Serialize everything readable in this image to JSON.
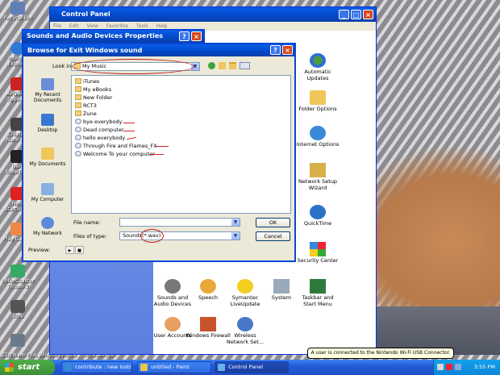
{
  "desktop": {
    "icons": [
      {
        "label": "Recycle Bin",
        "icon": "recycle-bin-icon"
      },
      {
        "label": "Internet Explorer",
        "icon": "internet-explorer-icon"
      },
      {
        "label": "AVG Anti-Spyware",
        "icon": "avg-icon"
      },
      {
        "label": "Creative Nano M...",
        "icon": "creative-icon"
      },
      {
        "label": "Nero ShowTime",
        "icon": "nero-icon"
      },
      {
        "label": "Nero StartSmart",
        "icon": "nero-start-icon"
      },
      {
        "label": "Play Games",
        "icon": "games-icon"
      },
      {
        "label": "RollerCoaster Tycoon 3",
        "icon": "rollercoaster-icon"
      },
      {
        "label": "Xfire",
        "icon": "xfire-icon"
      },
      {
        "label": "ZEN Nano Plus",
        "icon": "zen-icon"
      }
    ],
    "bottom_labels": [
      "Windows Media ...",
      "Minesweeper"
    ]
  },
  "control_panel": {
    "title": "Control Panel",
    "menu": [
      "File",
      "Edit",
      "View",
      "Favorites",
      "Tools",
      "Help"
    ],
    "items": [
      {
        "label": "Automatic Updates",
        "icon": "automatic-updates-icon"
      },
      {
        "label": "Folder Options",
        "icon": "folder-options-icon"
      },
      {
        "label": "Internet Options",
        "icon": "internet-options-icon"
      },
      {
        "label": "Network Setup Wizard",
        "icon": "network-setup-icon"
      },
      {
        "label": "QuickTime",
        "icon": "quicktime-icon"
      },
      {
        "label": "Security Center",
        "icon": "security-center-icon"
      },
      {
        "label": "Sounds and Audio Devices",
        "icon": "sounds-icon"
      },
      {
        "label": "Speech",
        "icon": "speech-icon"
      },
      {
        "label": "Symantec LiveUpdate",
        "icon": "liveupdate-icon"
      },
      {
        "label": "System",
        "icon": "system-icon"
      },
      {
        "label": "Taskbar and Start Menu",
        "icon": "taskbar-icon"
      },
      {
        "label": "User Accounts",
        "icon": "user-accounts-icon"
      },
      {
        "label": "Windows Firewall",
        "icon": "firewall-icon"
      },
      {
        "label": "Wireless Network Set...",
        "icon": "wireless-icon"
      }
    ]
  },
  "sounds_dialog": {
    "title": "Sounds and Audio Devices Properties"
  },
  "browse_dialog": {
    "title": "Browse for Exit Windows sound",
    "look_in_label": "Look in:",
    "look_in_value": "My Music",
    "places": [
      {
        "label": "My Recent Documents",
        "icon": "recent-documents-icon"
      },
      {
        "label": "Desktop",
        "icon": "desktop-icon"
      },
      {
        "label": "My Documents",
        "icon": "my-documents-icon"
      },
      {
        "label": "My Computer",
        "icon": "my-computer-icon"
      },
      {
        "label": "My Network",
        "icon": "my-network-icon"
      }
    ],
    "files": [
      {
        "name": "iTunes",
        "type": "folder"
      },
      {
        "name": "My eBooks",
        "type": "folder"
      },
      {
        "name": "New Folder",
        "type": "folder"
      },
      {
        "name": "RCT3",
        "type": "folder"
      },
      {
        "name": "Zune",
        "type": "folder"
      },
      {
        "name": "bye everybody",
        "type": "audio"
      },
      {
        "name": "Dead computer",
        "type": "audio"
      },
      {
        "name": "hello everybody",
        "type": "audio"
      },
      {
        "name": "Through Fire and Flames_FX",
        "type": "audio"
      },
      {
        "name": "Welcome To your computer",
        "type": "audio"
      }
    ],
    "file_name_label": "File name:",
    "file_name_value": "",
    "files_of_type_label": "Files of type:",
    "files_of_type_value": "Sounds(*.wav)",
    "preview_label": "Preview:",
    "ok_label": "OK",
    "cancel_label": "Cancel"
  },
  "tooltip": "A user is connected to the Nintendo Wi-Fi USB Connector.",
  "taskbar": {
    "start_label": "start",
    "tasks": [
      {
        "label": "contribute : new instr...",
        "active": false
      },
      {
        "label": "untitled - Paint",
        "active": false
      },
      {
        "label": "Control Panel",
        "active": true
      }
    ],
    "clock": "3:55 PM"
  },
  "colors": {
    "titlebar": "#0148c8",
    "annotation": "#c0201c",
    "start": "#3a8f35"
  }
}
